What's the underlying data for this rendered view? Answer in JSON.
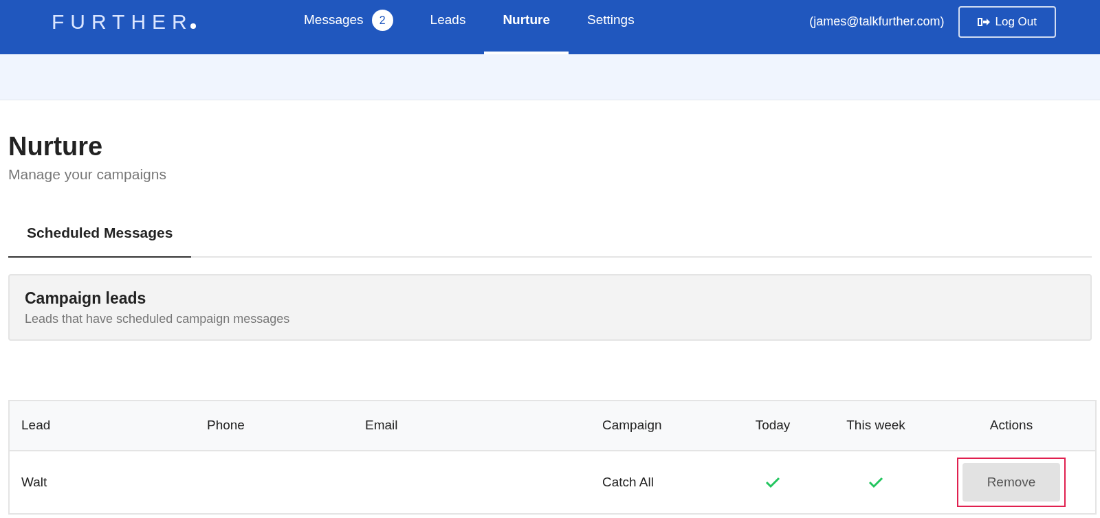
{
  "nav": {
    "logo": "FURTHER",
    "items": [
      {
        "label": "Messages",
        "badge": "2",
        "selected": false
      },
      {
        "label": "Leads",
        "selected": false
      },
      {
        "label": "Nurture",
        "selected": true
      },
      {
        "label": "Settings",
        "selected": false
      }
    ],
    "user": "(james@talkfurther.com)",
    "logout": "Log Out"
  },
  "page": {
    "title": "Nurture",
    "subtitle": "Manage your campaigns"
  },
  "tabs": [
    {
      "label": "Scheduled Messages",
      "selected": true
    }
  ],
  "panel": {
    "title": "Campaign leads",
    "subtitle": "Leads that have scheduled campaign messages"
  },
  "table": {
    "columns": [
      "Lead",
      "Phone",
      "Email",
      "Campaign",
      "Today",
      "This week",
      "Actions"
    ],
    "rows": [
      {
        "lead": "Walt",
        "phone": "",
        "email": "",
        "campaign": "Catch All",
        "today": true,
        "this_week": true,
        "action": "Remove",
        "highlighted": true
      }
    ]
  }
}
